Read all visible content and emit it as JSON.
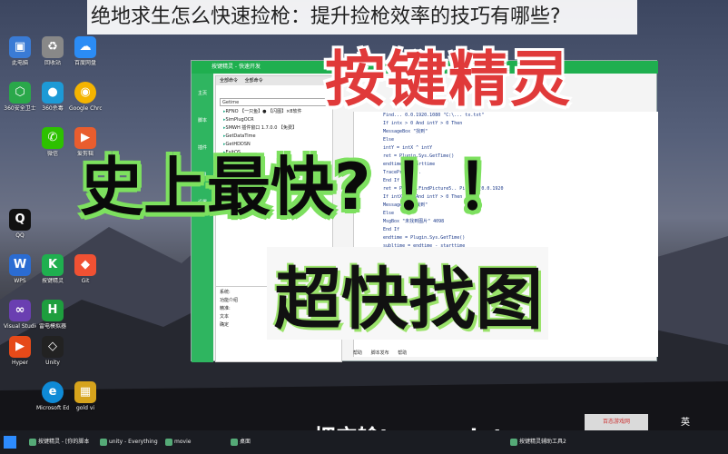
{
  "title": "绝地求生怎么快速捡枪：提升捡枪效率的技巧有哪些?",
  "overlay": {
    "red": "按键精灵",
    "green": "史上最快? ！！",
    "box": "超快找图",
    "caption": "把它输transprint"
  },
  "window": {
    "title": "按键精灵 - 快速开发",
    "rail": [
      "主页",
      "脚本",
      "插件",
      "工具",
      "设置"
    ],
    "tabs": [
      "全部命令",
      "全部命令"
    ],
    "search": "Getime",
    "commands": [
      "RFNO 【一只鱼】● 【闪图】×8软件",
      "SimPlugOCR",
      "SMWH 插件窗口 1.7.0.0 【免费】",
      "GetDataTime",
      "GetHDDSN",
      "ExitOS",
      "GetCLB",
      "GetDis"
    ],
    "props": [
      "系统:",
      "功能介绍",
      "精准:",
      "文本",
      "确定"
    ],
    "code": [
      "Find... 0.0.1920.1080 \"C:\\... tx.txt\"",
      "If intx > 0 And intY > 0 Then",
      "  MessageBox \"找到\"",
      "Else",
      "  intY = intX ^ intY",
      "  ret = Plugin.Sys.GetTime()",
      "  endtime = starttime",
      "  TracePrint ...",
      "End If",
      "",
      "ret = Plugin.FindPicture5.. Picture(0.0.1920",
      "If intX > 0 And intY > 0 Then",
      "  MessageBox \"找到\"",
      "Else",
      "  MsgBox \"未找到图片\" 4098",
      "End If",
      "endtime = Plugin.Sys.GetTime()",
      "subltime = endtime - starttime",
      "TracePrint subltime"
    ],
    "bottom_tabs": [
      "帮助",
      "脚本发布",
      "帮助"
    ]
  },
  "desktop_icons": [
    "此电脑",
    "回收站",
    "360安全卫士",
    "360杀毒",
    "Google Chrome",
    "QQ",
    "微信",
    "爱剪辑",
    "WPS",
    "按键精灵",
    "Unity",
    "Visual Studio",
    "Git",
    "雷电模拟器",
    "百度网盘",
    "Hyper",
    "Microsoft Edge",
    "gold vi"
  ],
  "taskbar": {
    "items": [
      "按键精灵 - [你的脚本]",
      "movie",
      "unity - Everything",
      "桌面",
      "按键精灵辅助工具2"
    ],
    "watermark": "百态游戏网",
    "tray": "英"
  }
}
